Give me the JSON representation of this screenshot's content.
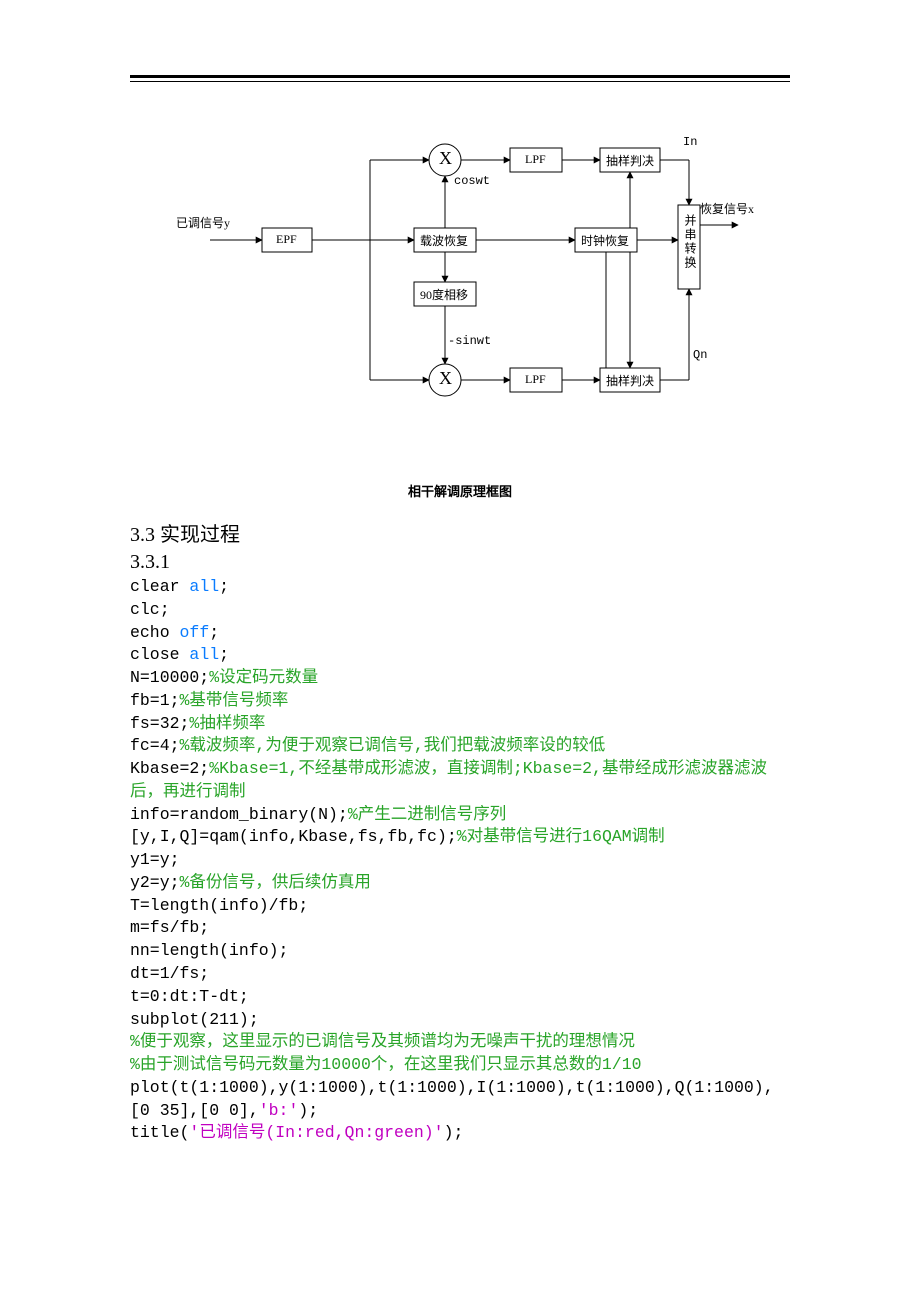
{
  "figure": {
    "input_label": "已调信号y",
    "epf": "EPF",
    "mult_top": "X",
    "mult_bot": "X",
    "coswt": "coswt",
    "neg_sinwt": "-sinwt",
    "lpf_top": "LPF",
    "lpf_bot": "LPF",
    "sample_top": "抽样判决",
    "sample_bot": "抽样判决",
    "in_label": "In",
    "qn_label": "Qn",
    "carrier_recover": "载波恢复",
    "clock_recover": "时钟恢复",
    "phase_shift": "90度相移",
    "ps_converter": "并串转换",
    "output_label": "恢复信号x"
  },
  "caption": "相干解调原理框图",
  "heading": "3.3  实现过程",
  "subheading": "3.3.1",
  "code": {
    "l1a": "clear ",
    "l1b": "all",
    "l1c": ";",
    "l2": "clc;",
    "l3a": "echo ",
    "l3b": "off",
    "l3c": ";",
    "l4a": "close ",
    "l4b": "all",
    "l4c": ";",
    "l5a": "N=10000;",
    "l5b": "%设定码元数量",
    "l6a": "fb=1;",
    "l6b": "%基带信号频率",
    "l7a": "fs=32;",
    "l7b": "%抽样频率",
    "l8a": "fc=4;",
    "l8b": "%载波频率,为便于观察已调信号,我们把载波频率设的较低",
    "l9a": "Kbase=2;",
    "l9b": "%Kbase=1,不经基带成形滤波，直接调制;Kbase=2,基带经成形滤波器滤波后，再进行调制",
    "l10a": "info=random_binary(N);",
    "l10b": "%产生二进制信号序列",
    "l11a": "[y,I,Q]=qam(info,Kbase,fs,fb,fc);",
    "l11b": "%对基带信号进行16QAM调制",
    "l12": "y1=y;",
    "l13a": "y2=y;",
    "l13b": "%备份信号，供后续仿真用",
    "l14": "T=length(info)/fb;",
    "l15": "m=fs/fb;",
    "l16": "nn=length(info);",
    "l17": "dt=1/fs;",
    "l18": "t=0:dt:T-dt;",
    "l19": "subplot(211);",
    "l20": "%便于观察，这里显示的已调信号及其频谱均为无噪声干扰的理想情况",
    "l21": "%由于测试信号码元数量为10000个，在这里我们只显示其总数的1/10",
    "l22a": "plot(t(1:1000),y(1:1000),t(1:1000),I(1:1000),t(1:1000),Q(1:1000),[0 35],[0 0],",
    "l22b": "'b:'",
    "l22c": ");",
    "l23a": "title(",
    "l23b": "'已调信号(In:red,Qn:green)'",
    "l23c": ");"
  }
}
